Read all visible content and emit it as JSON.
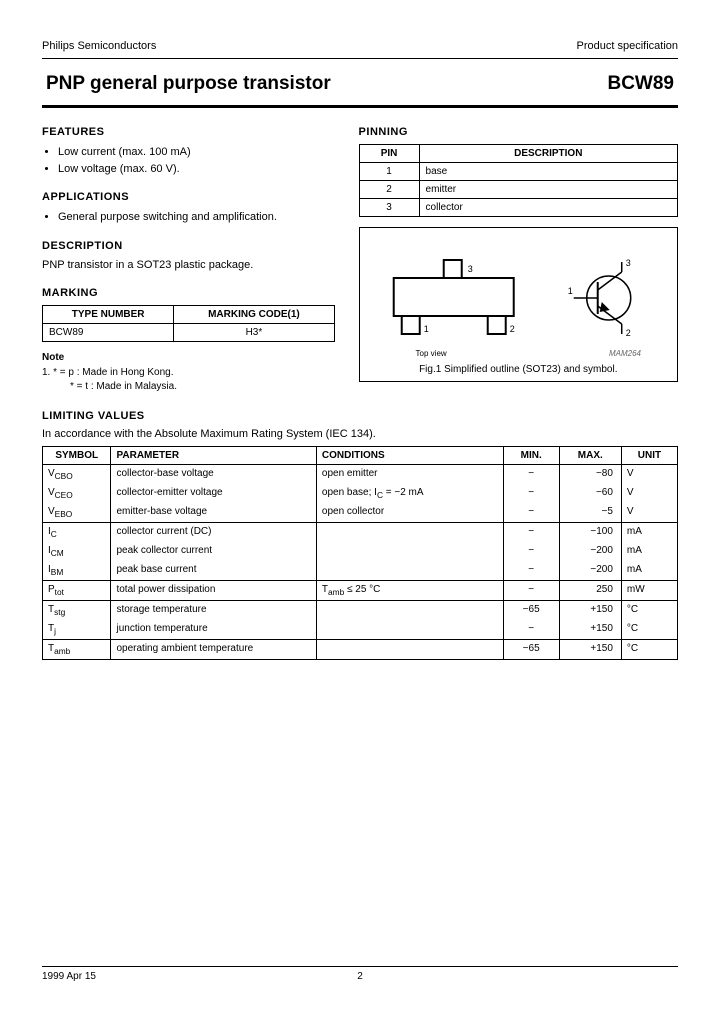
{
  "header": {
    "left": "Philips Semiconductors",
    "right": "Product specification"
  },
  "title": {
    "left": "PNP general purpose transistor",
    "right": "BCW89"
  },
  "features": {
    "heading": "FEATURES",
    "items": [
      "Low current (max. 100 mA)",
      "Low voltage (max. 60 V)."
    ]
  },
  "applications": {
    "heading": "APPLICATIONS",
    "items": [
      "General purpose switching and amplification."
    ]
  },
  "description": {
    "heading": "DESCRIPTION",
    "text": "PNP transistor in a SOT23 plastic package."
  },
  "marking": {
    "heading": "MARKING",
    "th1": "TYPE NUMBER",
    "th2": "MARKING CODE(1)",
    "row": {
      "type": "BCW89",
      "code": "H3*"
    }
  },
  "note": {
    "heading": "Note",
    "text1": "1.  * = p : Made in Hong Kong.",
    "text2": "* = t : Made in Malaysia."
  },
  "pinning": {
    "heading": "PINNING",
    "th1": "PIN",
    "th2": "DESCRIPTION",
    "rows": [
      {
        "pin": "1",
        "desc": "base"
      },
      {
        "pin": "2",
        "desc": "emitter"
      },
      {
        "pin": "3",
        "desc": "collector"
      }
    ]
  },
  "figure": {
    "topview": "Top view",
    "ref": "MAM264",
    "caption": "Fig.1  Simplified outline (SOT23) and symbol."
  },
  "limiting": {
    "heading": "LIMITING VALUES",
    "sub": "In accordance with the Absolute Maximum Rating System (IEC 134).",
    "headers": {
      "sym": "SYMBOL",
      "param": "PARAMETER",
      "cond": "CONDITIONS",
      "min": "MIN.",
      "max": "MAX.",
      "unit": "UNIT"
    },
    "rows": [
      {
        "sym": "V<sub>CBO</sub>",
        "param": "collector-base voltage",
        "cond": "open emitter",
        "min": "−",
        "max": "−80",
        "unit": "V"
      },
      {
        "sym": "V<sub>CEO</sub>",
        "param": "collector-emitter voltage",
        "cond": "open base; I<sub>C</sub> = −2 mA",
        "min": "−",
        "max": "−60",
        "unit": "V"
      },
      {
        "sym": "V<sub>EBO</sub>",
        "param": "emitter-base voltage",
        "cond": "open collector",
        "min": "−",
        "max": "−5",
        "unit": "V"
      },
      {
        "sym": "I<sub>C</sub>",
        "param": "collector current (DC)",
        "cond": "",
        "min": "−",
        "max": "−100",
        "unit": "mA"
      },
      {
        "sym": "I<sub>CM</sub>",
        "param": "peak collector current",
        "cond": "",
        "min": "−",
        "max": "−200",
        "unit": "mA"
      },
      {
        "sym": "I<sub>BM</sub>",
        "param": "peak base current",
        "cond": "",
        "min": "−",
        "max": "−200",
        "unit": "mA"
      },
      {
        "sym": "P<sub>tot</sub>",
        "param": "total power dissipation",
        "cond": "T<sub>amb</sub> ≤ 25 °C",
        "min": "−",
        "max": "250",
        "unit": "mW"
      },
      {
        "sym": "T<sub>stg</sub>",
        "param": "storage temperature",
        "cond": "",
        "min": "−65",
        "max": "+150",
        "unit": "°C"
      },
      {
        "sym": "T<sub>j</sub>",
        "param": "junction temperature",
        "cond": "",
        "min": "−",
        "max": "+150",
        "unit": "°C"
      },
      {
        "sym": "T<sub>amb</sub>",
        "param": "operating ambient temperature",
        "cond": "",
        "min": "−65",
        "max": "+150",
        "unit": "°C"
      }
    ],
    "group_breaks": [
      3,
      6,
      7,
      9
    ]
  },
  "footer": {
    "left": "1999 Apr 15",
    "center": "2"
  }
}
